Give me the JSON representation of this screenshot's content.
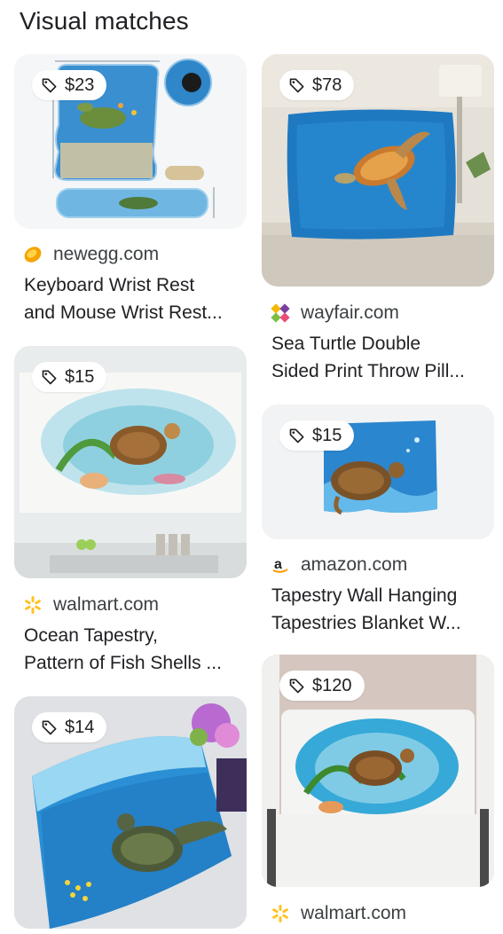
{
  "header": {
    "title": "Visual matches"
  },
  "results": [
    {
      "price": "$23",
      "source": "newegg.com",
      "title_line1": "Keyboard Wrist Rest",
      "title_line2": "and Mouse Wrist Rest..."
    },
    {
      "price": "$78",
      "source": "wayfair.com",
      "title_line1": "Sea Turtle Double",
      "title_line2": "Sided Print Throw Pill..."
    },
    {
      "price": "$15",
      "source": "walmart.com",
      "title_line1": "Ocean Tapestry,",
      "title_line2": "Pattern of Fish Shells ..."
    },
    {
      "price": "$15",
      "source": "amazon.com",
      "title_line1": "Tapestry Wall Hanging",
      "title_line2": "Tapestries Blanket W..."
    },
    {
      "price": "$14",
      "source": "",
      "title_line1": "",
      "title_line2": ""
    },
    {
      "price": "$120",
      "source": "walmart.com",
      "title_line1": "",
      "title_line2": ""
    }
  ],
  "icons": {
    "price_tag": "price-tag-icon",
    "newegg": "newegg-favicon-icon",
    "wayfair": "wayfair-favicon-icon",
    "walmart": "walmart-favicon-icon",
    "amazon": "amazon-favicon-icon"
  },
  "colors": {
    "text": "#202124",
    "source_text": "#3c4043",
    "card_bg": "#f1f3f4",
    "ocean_blue": "#1e88c8",
    "walmart_yellow": "#ffc220"
  }
}
